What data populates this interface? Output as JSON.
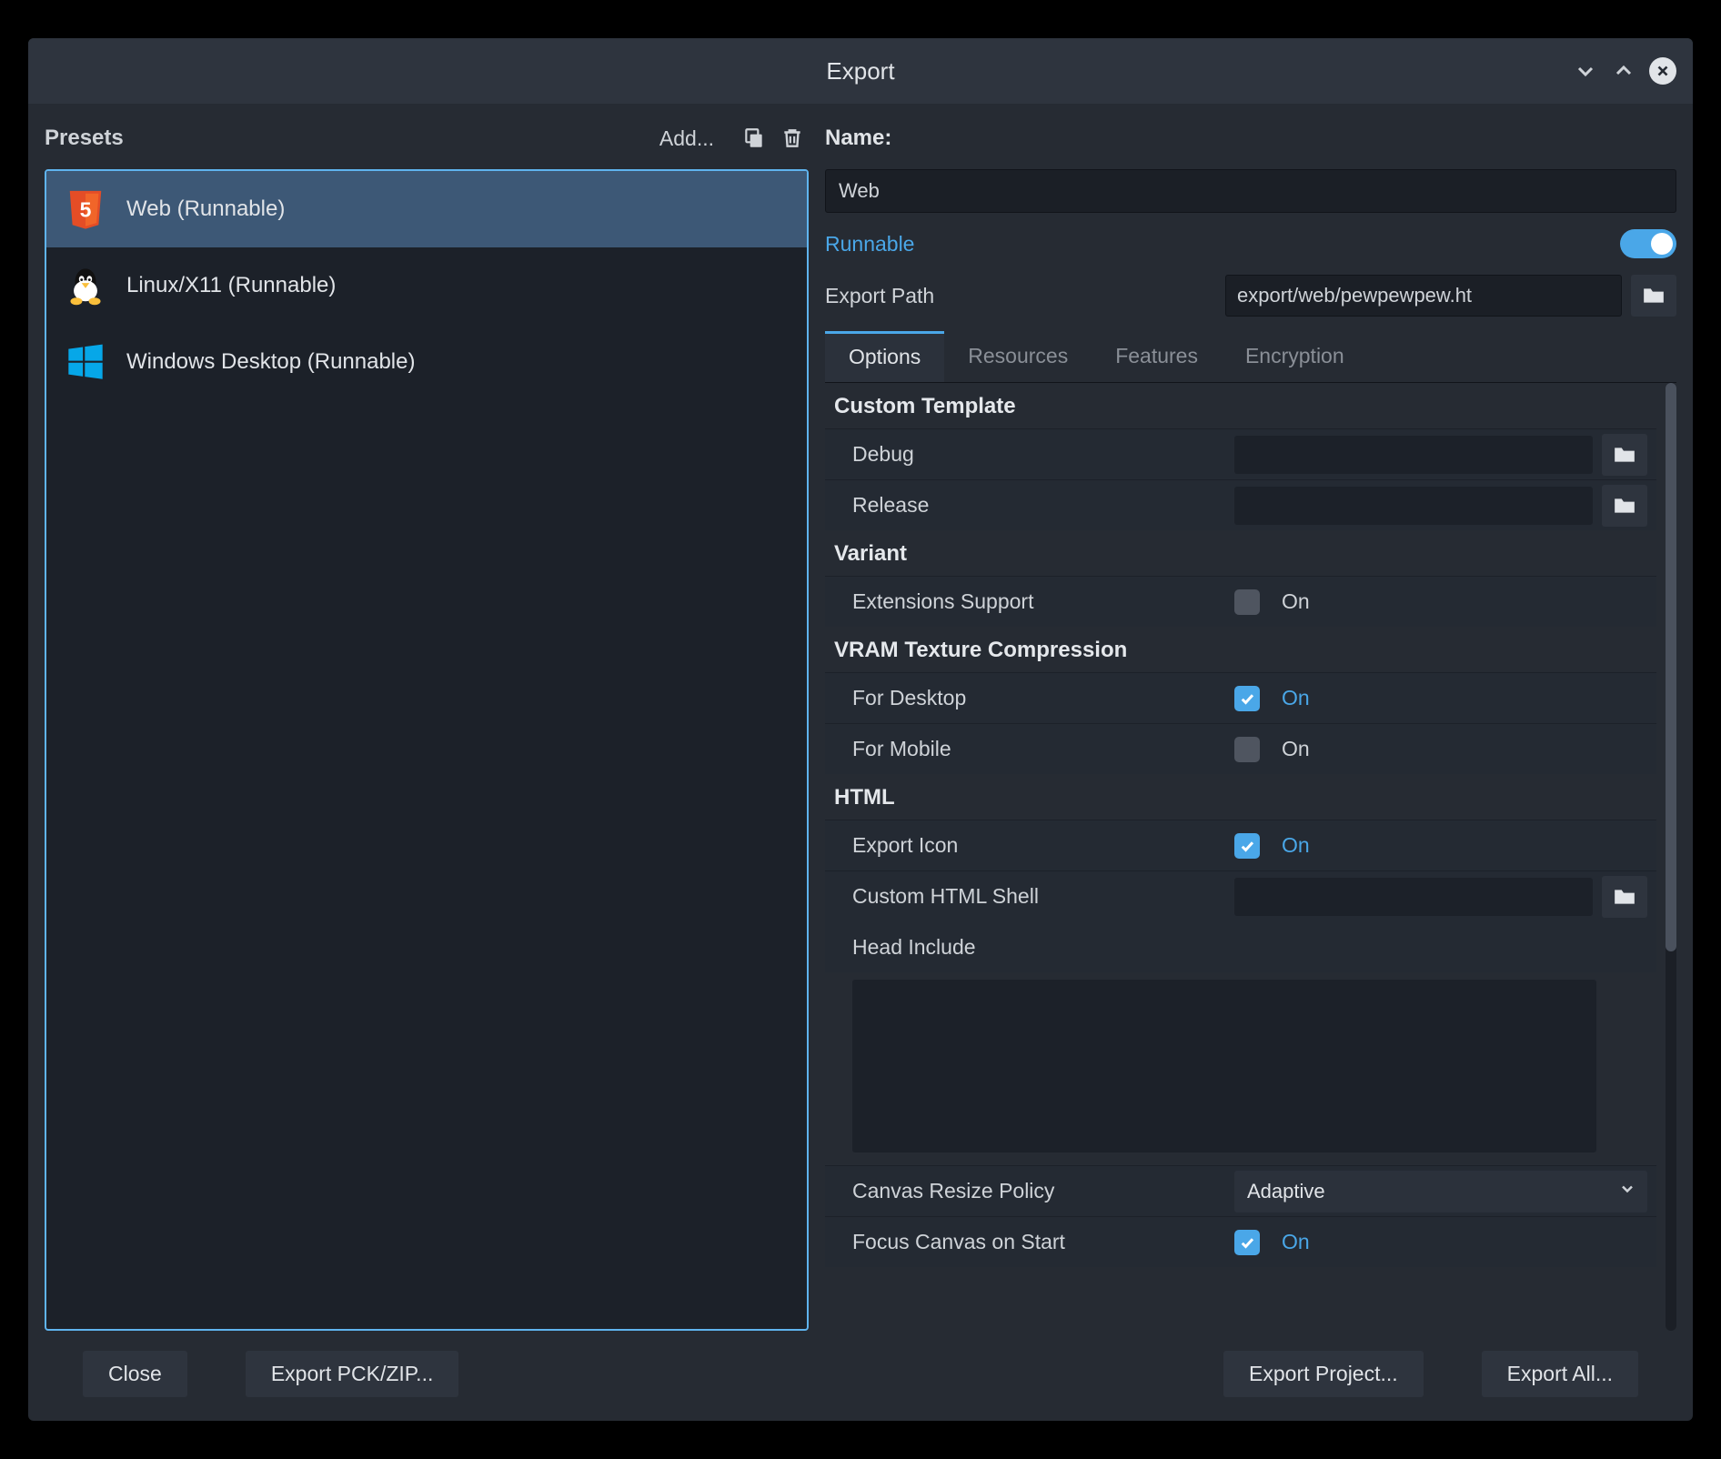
{
  "dialog": {
    "title": "Export"
  },
  "left": {
    "presets_label": "Presets",
    "add_label": "Add...",
    "items": [
      {
        "label": "Web (Runnable)"
      },
      {
        "label": "Linux/X11 (Runnable)"
      },
      {
        "label": "Windows Desktop (Runnable)"
      }
    ]
  },
  "right": {
    "name_label": "Name:",
    "name_value": "Web",
    "runnable_label": "Runnable",
    "export_path_label": "Export Path",
    "export_path_value": "export/web/pewpewpew.ht",
    "tabs": {
      "options": "Options",
      "resources": "Resources",
      "features": "Features",
      "encryption": "Encryption"
    },
    "sections": {
      "custom_template": "Custom Template",
      "debug": "Debug",
      "release": "Release",
      "variant": "Variant",
      "extensions_support": "Extensions Support",
      "vram": "VRAM Texture Compression",
      "for_desktop": "For Desktop",
      "for_mobile": "For Mobile",
      "html": "HTML",
      "export_icon": "Export Icon",
      "custom_html_shell": "Custom HTML Shell",
      "head_include": "Head Include",
      "canvas_resize_policy": "Canvas Resize Policy",
      "canvas_resize_value": "Adaptive",
      "focus_canvas": "Focus Canvas on Start",
      "on_label": "On"
    }
  },
  "footer": {
    "close": "Close",
    "export_pck_zip": "Export PCK/ZIP...",
    "export_project": "Export Project...",
    "export_all": "Export All..."
  }
}
